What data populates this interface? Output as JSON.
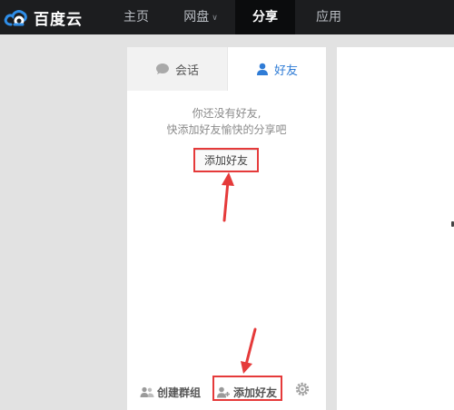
{
  "header": {
    "brand": "百度云",
    "nav": [
      {
        "label": "主页"
      },
      {
        "label": "网盘",
        "has_dropdown": true
      },
      {
        "label": "分享",
        "active": true
      },
      {
        "label": "应用"
      }
    ]
  },
  "panel": {
    "tabs": {
      "chat": "会话",
      "friends": "好友"
    },
    "empty": {
      "line1": "你还没有好友,",
      "line2": "快添加好友愉快的分享吧",
      "add_button": "添加好友"
    },
    "footer": {
      "create_group": "创建群组",
      "add_friend": "添加好友"
    }
  },
  "colors": {
    "topbar": "#1c1d1f",
    "accent_blue": "#2f7cd6",
    "highlight_red": "#e53a3a"
  }
}
